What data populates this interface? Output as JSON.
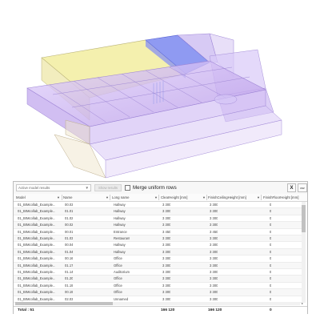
{
  "toolbar": {
    "source_select": "Active model results",
    "show_results_label": "Show results",
    "merge_label": "Merge uniform rows",
    "merge_checked": false,
    "close_label": "X",
    "csv_label": "csv"
  },
  "columns": [
    "Model",
    "Name",
    "Long name",
    "ClearHeight [mm]",
    "FinishCeilingHeight [mm]",
    "FinishFloorHeight [mm]"
  ],
  "rows": [
    [
      "01_BIMcollab_Example...",
      "00.03",
      "Hallway",
      "3 300",
      "3 300",
      "0"
    ],
    [
      "01_BIMcollab_Example...",
      "01.01",
      "Hallway",
      "3 300",
      "3 300",
      "0"
    ],
    [
      "01_BIMcollab_Example...",
      "01.02",
      "Hallway",
      "3 300",
      "3 300",
      "0"
    ],
    [
      "01_BIMcollab_Example...",
      "00.02",
      "Hallway",
      "3 300",
      "3 300",
      "0"
    ],
    [
      "01_BIMcollab_Example...",
      "00.01",
      "Entrance",
      "3 450",
      "3 450",
      "0"
    ],
    [
      "01_BIMcollab_Example...",
      "01.03",
      "Restaurant",
      "3 300",
      "3 300",
      "0"
    ],
    [
      "01_BIMcollab_Example...",
      "00.04",
      "Hallway",
      "3 300",
      "3 300",
      "0"
    ],
    [
      "01_BIMcollab_Example...",
      "01.04",
      "Hallway",
      "3 300",
      "3 300",
      "0"
    ],
    [
      "01_BIMcollab_Example...",
      "00.16",
      "Office",
      "3 300",
      "3 300",
      "0"
    ],
    [
      "01_BIMcollab_Example...",
      "01.17",
      "Office",
      "3 300",
      "3 300",
      "0"
    ],
    [
      "01_BIMcollab_Example...",
      "01.14",
      "Auditorium",
      "3 300",
      "3 300",
      "0"
    ],
    [
      "01_BIMcollab_Example...",
      "01.20",
      "Office",
      "3 300",
      "3 300",
      "0"
    ],
    [
      "01_BIMcollab_Example...",
      "01.19",
      "Office",
      "3 300",
      "3 300",
      "0"
    ],
    [
      "01_BIMcollab_Example...",
      "00.19",
      "Office",
      "3 300",
      "3 300",
      "0"
    ],
    [
      "01_BIMcollab_Example...",
      "02.03",
      "Unnamed",
      "3 300",
      "3 300",
      "0"
    ]
  ],
  "footer": {
    "total_label": "Total : 51",
    "clear_height_sum": "166 120",
    "finish_ceiling_sum": "166 120",
    "finish_floor_sum": "0"
  },
  "colors": {
    "yellow_space": "#f3eea3",
    "purple_space": "#c9b1ee",
    "blue_space": "#6f7ef0"
  }
}
